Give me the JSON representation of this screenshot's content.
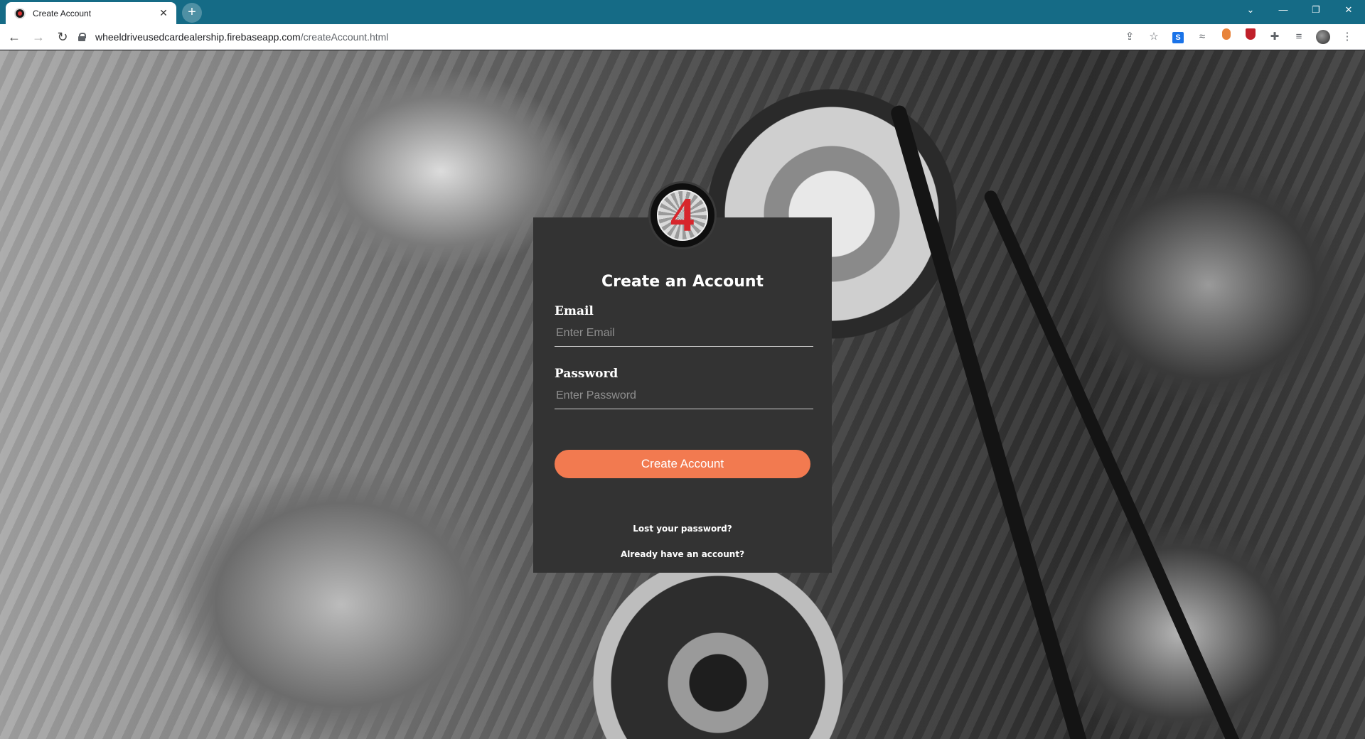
{
  "browser": {
    "tab_title": "Create Account",
    "tab_close": "✕",
    "new_tab": "+",
    "url_host": "wheeldriveusedcardealership.firebaseapp.com",
    "url_path": "/createAccount.html",
    "window_controls": [
      "⌄",
      "—",
      "❐",
      "✕"
    ]
  },
  "form": {
    "logo_text": "4",
    "title": "Create an Account",
    "email_label": "Email",
    "email_placeholder": "Enter Email",
    "email_value": "",
    "password_label": "Password",
    "password_placeholder": "Enter Password",
    "password_value": "",
    "submit_label": "Create Account",
    "lost_password_link": "Lost your password?",
    "have_account_link": "Already have an account?"
  },
  "colors": {
    "tabstrip": "#156b86",
    "card": "#333333",
    "accent_button": "#f27a50",
    "logo_red": "#d7262c"
  }
}
